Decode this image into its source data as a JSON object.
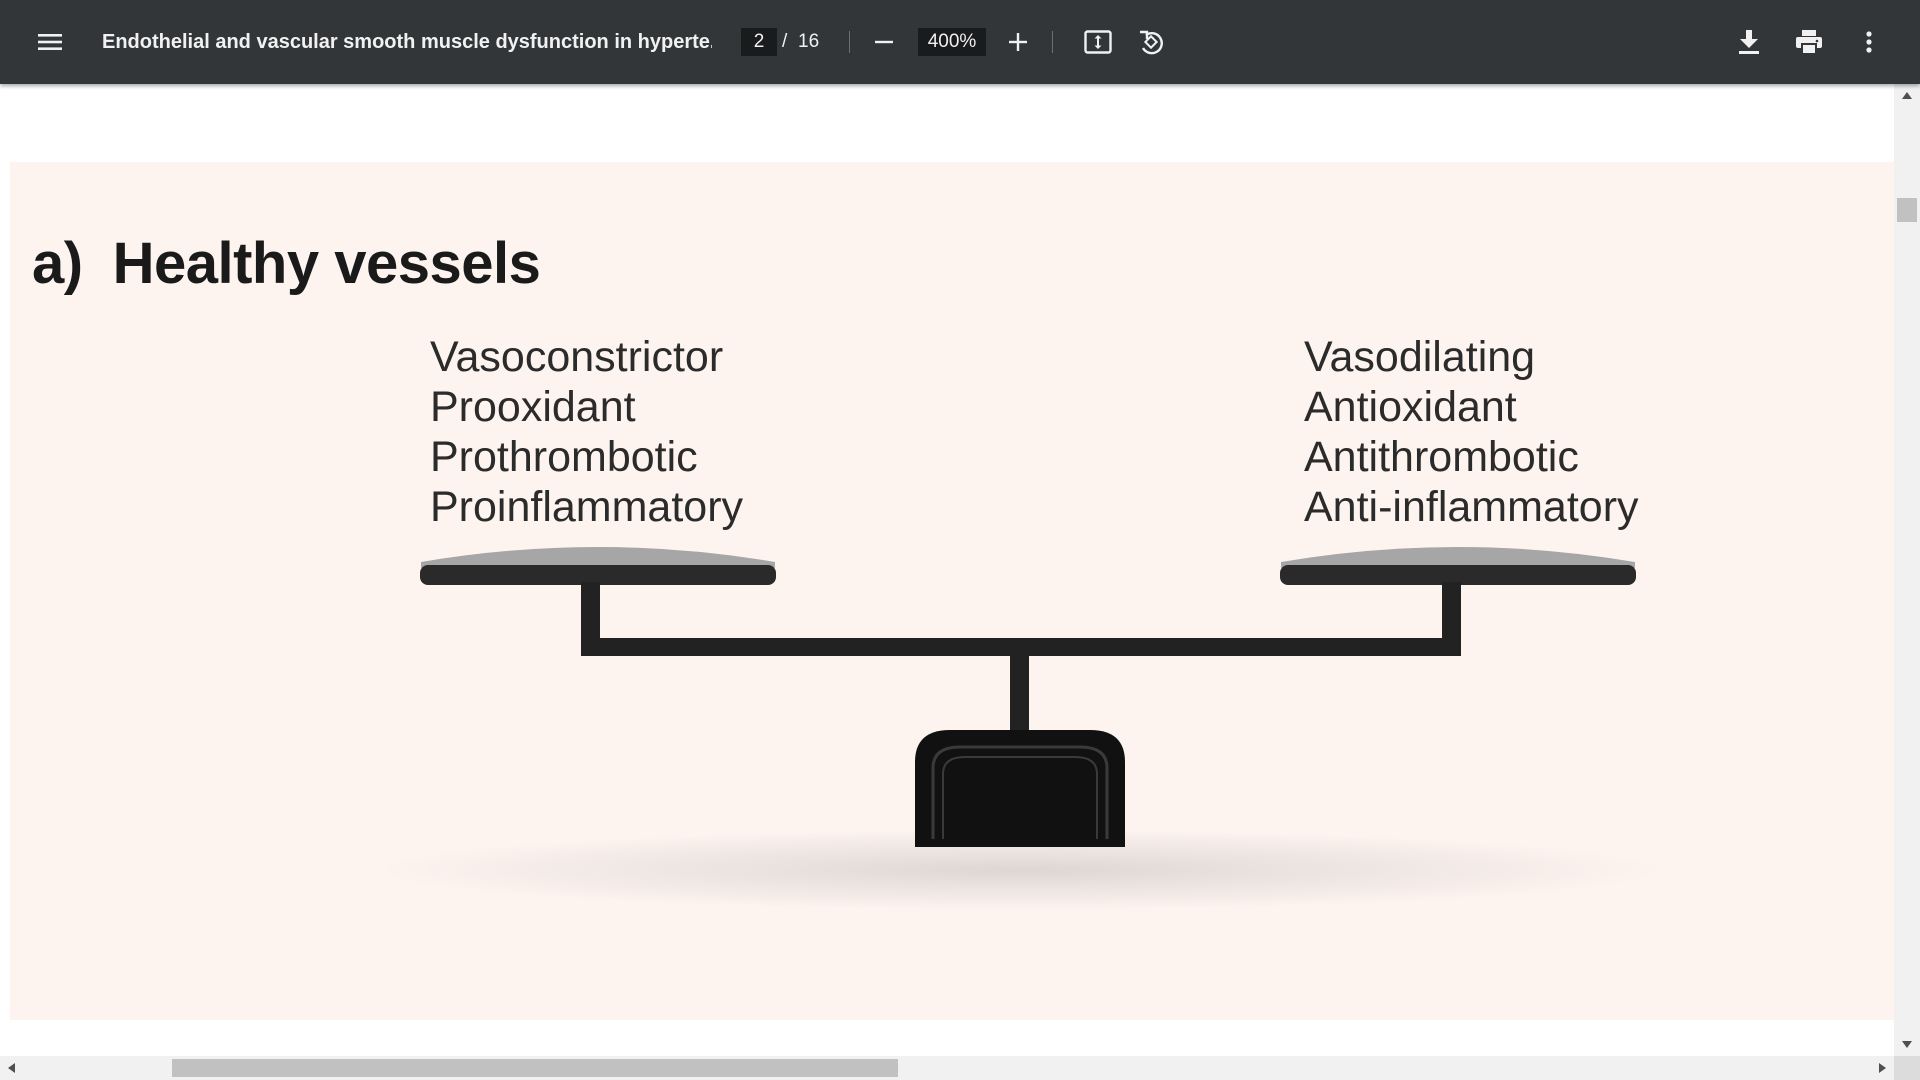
{
  "toolbar": {
    "title": "Endothelial and vascular smooth muscle dysfunction in hyperte...",
    "page_current": "2",
    "page_separator": "/",
    "page_total": "16",
    "zoom": "400%",
    "icons": {
      "menu": "menu-icon",
      "zoom_out": "minus-icon",
      "zoom_in": "plus-icon",
      "fit": "fit-to-page-icon",
      "rotate": "rotate-counterclockwise-icon",
      "download": "download-icon",
      "print": "print-icon",
      "more": "more-vert-icon"
    },
    "colors": {
      "background": "#323639",
      "text": "#f1f1f1",
      "input_background": "#191b1c"
    }
  },
  "document": {
    "figure_label": "a)",
    "figure_title": "Healthy vessels",
    "left_terms": [
      "Vasoconstrictor",
      "Prooxidant",
      "Prothrombotic",
      "Proinflammatory"
    ],
    "right_terms": [
      "Vasodilating",
      "Antioxidant",
      "Antithrombotic",
      "Anti-inflammatory"
    ],
    "colors": {
      "page_background": "#fdf3ef",
      "scale": "#1a1a1a",
      "pan_top": "#a6a6a6"
    }
  }
}
